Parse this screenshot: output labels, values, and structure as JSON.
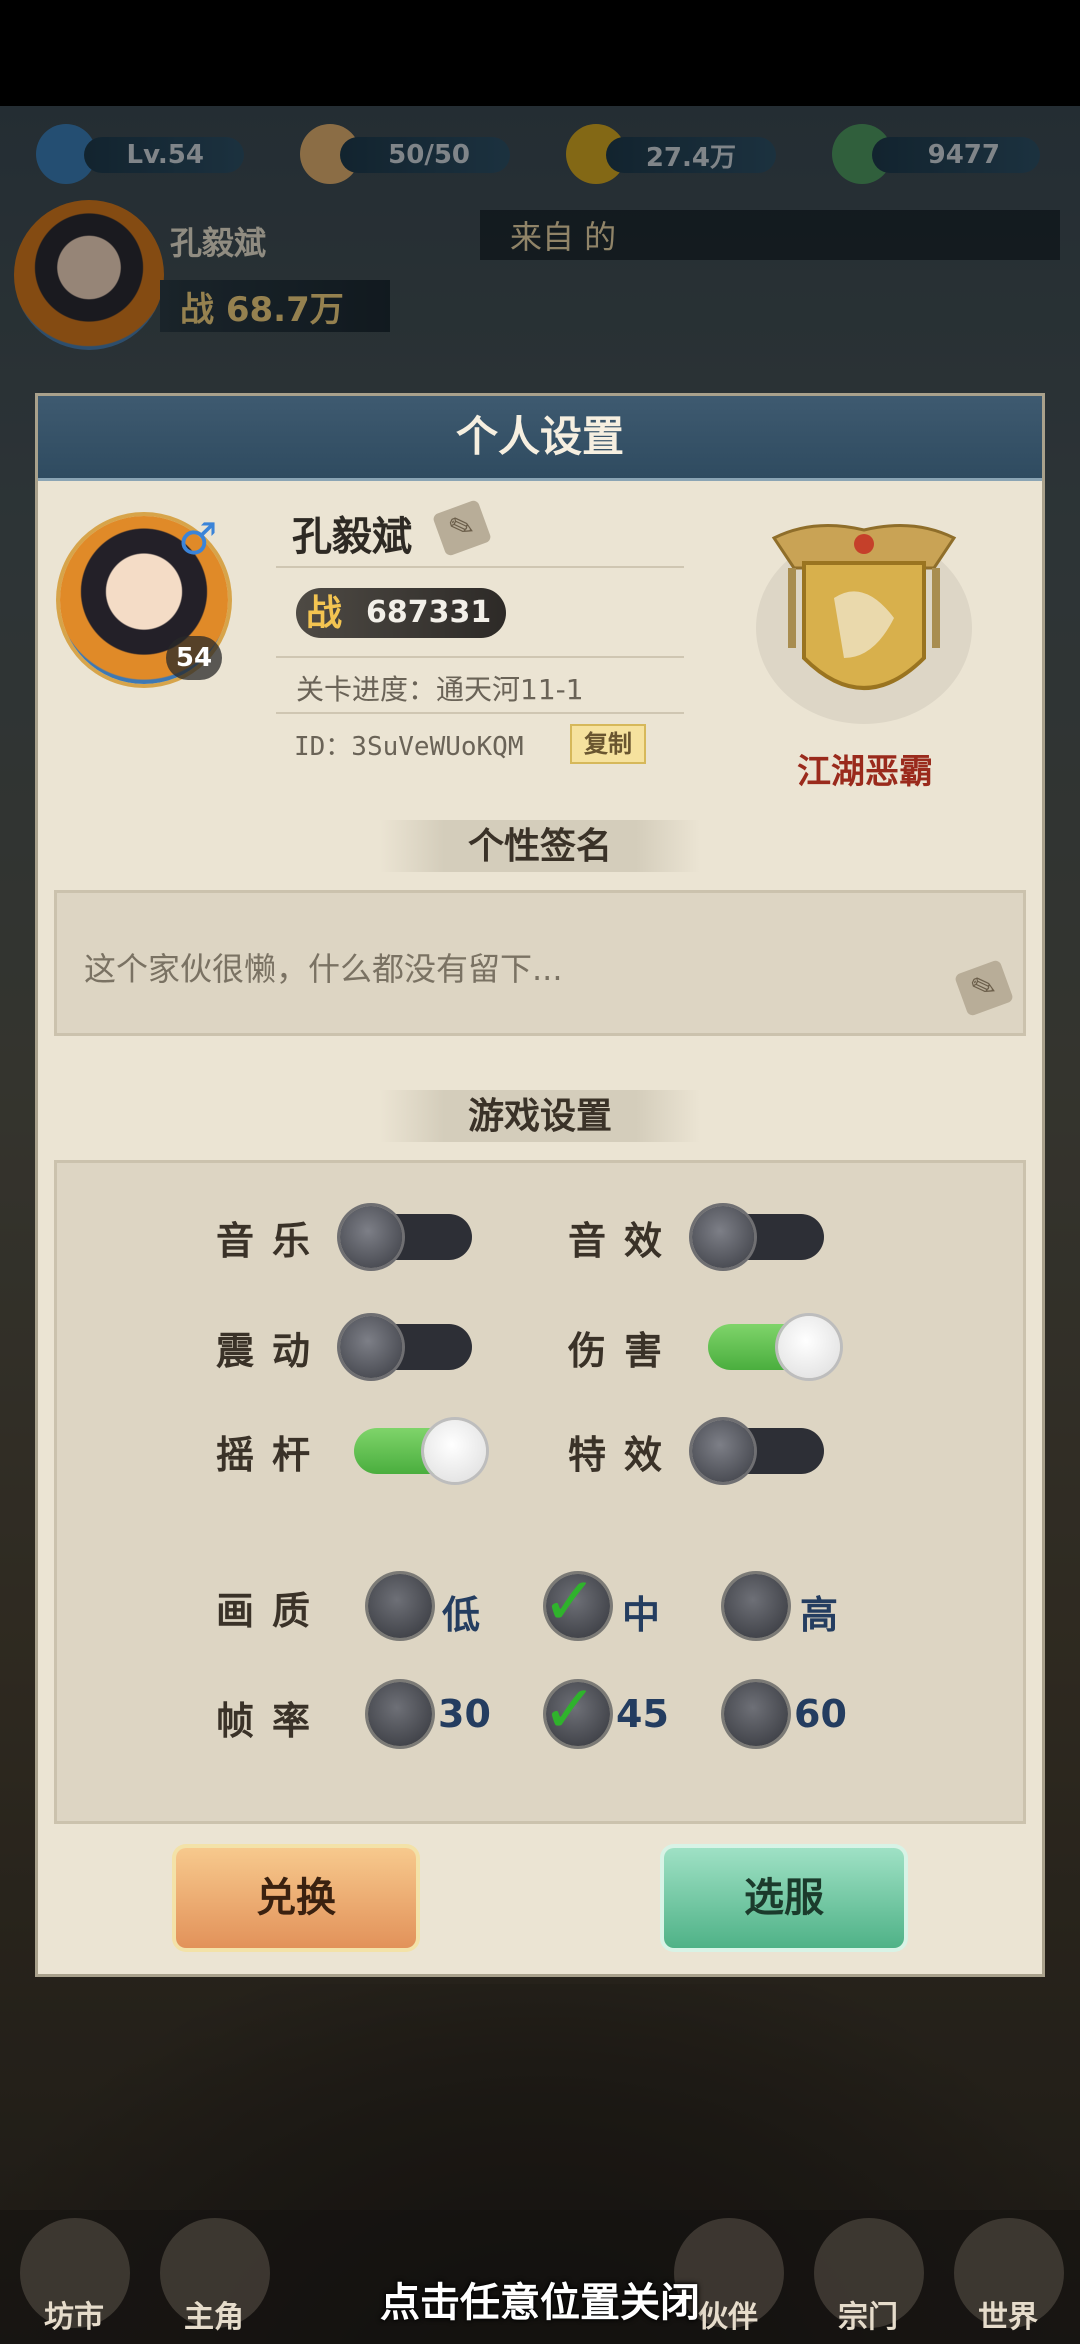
{
  "hud": {
    "level": "Lv.54",
    "stamina": "50/50",
    "coins": "27.4万",
    "jade": "9477",
    "player_name": "孔毅斌",
    "power_label": "战",
    "power_short": "68.7万",
    "ticker_text": "来自 的"
  },
  "panel": {
    "title": "个人设置",
    "name": "孔毅斌",
    "gender_symbol": "♂",
    "level": "54",
    "power_label": "战",
    "power_value": "687331",
    "stage_progress": "关卡进度：通天河11-1",
    "player_id": "ID：3SuVeWUoKQM",
    "copy_label": "复制",
    "rank_title": "江湖恶霸"
  },
  "signature": {
    "section_title": "个性签名",
    "text": "这个家伙很懒，什么都没有留下..."
  },
  "game_settings": {
    "section_title": "游戏设置",
    "toggles": [
      {
        "label": "音乐",
        "on": false
      },
      {
        "label": "音效",
        "on": false
      },
      {
        "label": "震动",
        "on": false
      },
      {
        "label": "伤害",
        "on": true
      },
      {
        "label": "摇杆",
        "on": true
      },
      {
        "label": "特效",
        "on": false
      }
    ],
    "quality": {
      "label": "画质",
      "options": [
        "低",
        "中",
        "高"
      ],
      "selected": "中"
    },
    "framerate": {
      "label": "帧率",
      "options": [
        "30",
        "45",
        "60"
      ],
      "selected": "45"
    }
  },
  "buttons": {
    "exchange": "兑换",
    "select_server": "选服"
  },
  "bottom_nav": [
    "坊市",
    "主角",
    "伙伴",
    "宗门",
    "世界"
  ],
  "close_hint": "点击任意位置关闭",
  "colors": {
    "header_blue": "#3e5a70",
    "panel_bg": "#ebe4d3",
    "toggle_on": "#4aae3e",
    "rank_red": "#9a2a1c",
    "exchange_orange": "#e2925a",
    "server_green": "#4fb287"
  }
}
